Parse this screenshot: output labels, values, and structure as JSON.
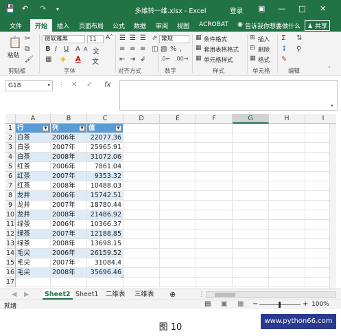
{
  "window": {
    "title": "多维转一维.xlsx - Excel",
    "login": "登录"
  },
  "ribbon_tabs": [
    "文件",
    "开始",
    "插入",
    "页面布局",
    "公式",
    "数据",
    "审阅",
    "视图",
    "ACROBAT"
  ],
  "tell_me": "告诉我你想要做什么",
  "share": "共享",
  "ribbon": {
    "paste": "粘贴",
    "font_name": "微软雅黑",
    "font_size": "11",
    "number_format": "常规",
    "styles": [
      "条件格式",
      "套用表格格式",
      "单元格样式"
    ],
    "cells": [
      "插入",
      "删除",
      "格式"
    ],
    "groups": [
      "剪贴板",
      "字体",
      "对齐方式",
      "数字",
      "样式",
      "单元格",
      "编辑"
    ]
  },
  "formula_bar": {
    "name_box": "G18",
    "fx": "fx",
    "content": ""
  },
  "columns": [
    "A",
    "B",
    "C",
    "D",
    "E",
    "F",
    "G",
    "H",
    "I"
  ],
  "selected_column": "G",
  "table": {
    "headers": [
      "行",
      "列",
      "值"
    ],
    "rows": [
      [
        "白茶",
        "2006年",
        "22077.36"
      ],
      [
        "白茶",
        "2007年",
        "25965.91"
      ],
      [
        "白茶",
        "2008年",
        "31072.06"
      ],
      [
        "红茶",
        "2006年",
        "7861.04"
      ],
      [
        "红茶",
        "2007年",
        "9353.32"
      ],
      [
        "红茶",
        "2008年",
        "10488.03"
      ],
      [
        "龙井",
        "2006年",
        "15742.51"
      ],
      [
        "龙井",
        "2007年",
        "18780.44"
      ],
      [
        "龙井",
        "2008年",
        "21486.92"
      ],
      [
        "绿茶",
        "2006年",
        "10366.37"
      ],
      [
        "绿茶",
        "2007年",
        "12188.85"
      ],
      [
        "绿茶",
        "2008年",
        "13698.15"
      ],
      [
        "毛尖",
        "2006年",
        "26159.52"
      ],
      [
        "毛尖",
        "2007年",
        "31084.4"
      ],
      [
        "毛尖",
        "2008年",
        "35696.46"
      ]
    ]
  },
  "row_numbers": [
    "1",
    "2",
    "3",
    "4",
    "5",
    "6",
    "7",
    "8",
    "9",
    "10",
    "11",
    "12",
    "13",
    "14",
    "15",
    "16",
    "17"
  ],
  "sheets": [
    "Sheet2",
    "Sheet1",
    "二维表",
    "三维表"
  ],
  "active_sheet": "Sheet2",
  "status": {
    "mode": "就绪",
    "zoom": "100%"
  },
  "caption": "图 10",
  "watermark": "www.python66.com"
}
